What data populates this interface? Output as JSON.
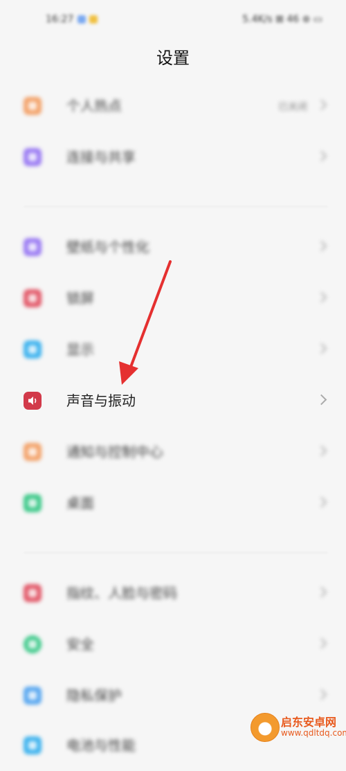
{
  "status_bar": {
    "time": "16:27",
    "right": "5.4K/s ⊠ 46 ⊛ ▭"
  },
  "title": "设置",
  "items": [
    {
      "label": "个人热点",
      "value": "已关闭",
      "color": "#f3a36b"
    },
    {
      "label": "连接与共享",
      "value": "",
      "color": "#9b7cf3"
    },
    {
      "label": "壁纸与个性化",
      "value": "",
      "color": "#9b7cf3"
    },
    {
      "label": "锁屏",
      "value": "",
      "color": "#e25a6a"
    },
    {
      "label": "显示",
      "value": "",
      "color": "#3fb3ee"
    },
    {
      "label": "声音与振动",
      "value": "",
      "color": "#d23a4a"
    },
    {
      "label": "通知与控制中心",
      "value": "",
      "color": "#f3a36b"
    },
    {
      "label": "桌面",
      "value": "",
      "color": "#3ec98a"
    },
    {
      "label": "指纹、人脸与密码",
      "value": "",
      "color": "#e25a6a"
    },
    {
      "label": "安全",
      "value": "",
      "color": "#3ec98a"
    },
    {
      "label": "隐私保护",
      "value": "",
      "color": "#5aa8f0"
    },
    {
      "label": "电池与性能",
      "value": "",
      "color": "#3fb3ee"
    }
  ],
  "watermark": {
    "title": "启东安卓网",
    "url": "www.qdltdq.com"
  },
  "colors": {
    "arrow": "#e53030",
    "background": "#f6f6f6"
  }
}
